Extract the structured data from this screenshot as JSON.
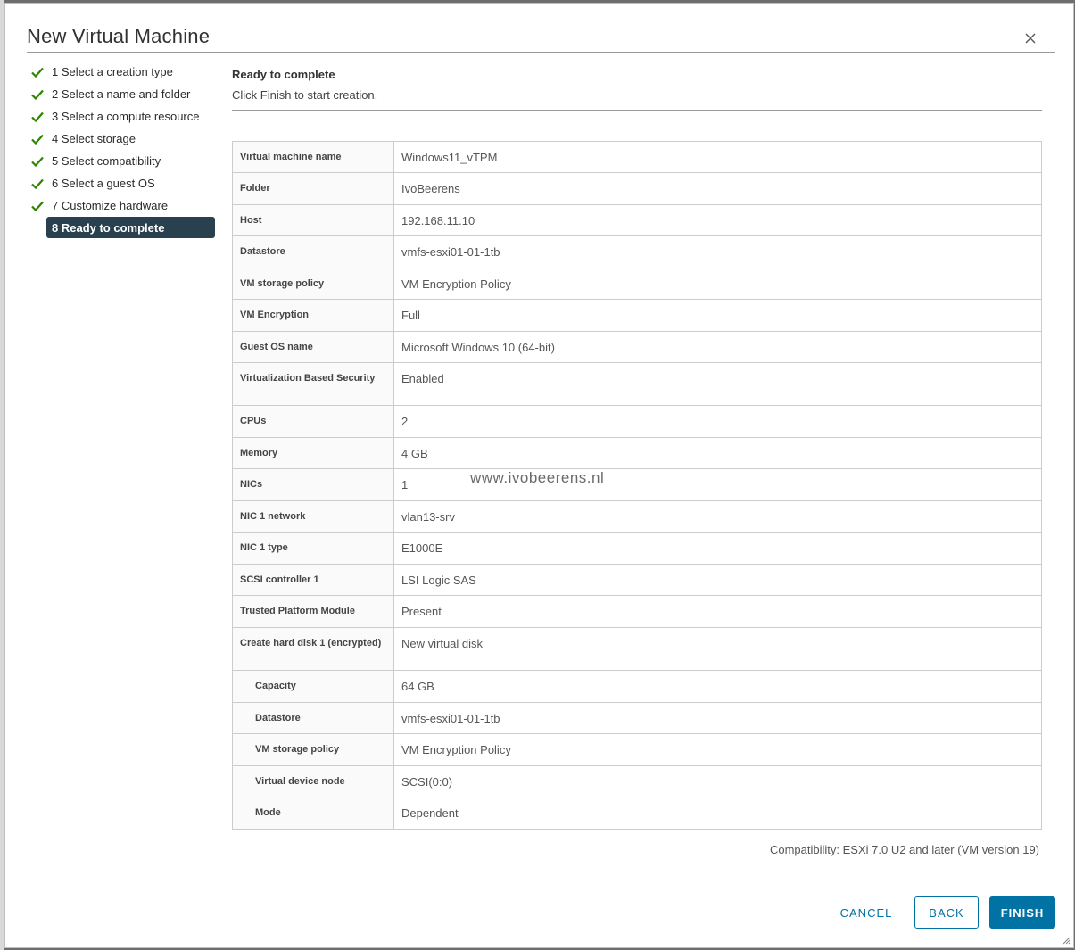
{
  "dialog": {
    "title": "New Virtual Machine",
    "close_icon": "close-icon"
  },
  "steps": [
    {
      "label": "1 Select a creation type",
      "done": true
    },
    {
      "label": "2 Select a name and folder",
      "done": true
    },
    {
      "label": "3 Select a compute resource",
      "done": true
    },
    {
      "label": "4 Select storage",
      "done": true
    },
    {
      "label": "5 Select compatibility",
      "done": true
    },
    {
      "label": "6 Select a guest OS",
      "done": true
    },
    {
      "label": "7 Customize hardware",
      "done": true
    },
    {
      "label": "8 Ready to complete",
      "done": false,
      "active": true
    }
  ],
  "content": {
    "title": "Ready to complete",
    "description": "Click Finish to start creation."
  },
  "summary": [
    {
      "label": "Virtual machine name",
      "value": "Windows11_vTPM"
    },
    {
      "label": "Folder",
      "value": "IvoBeerens"
    },
    {
      "label": "Host",
      "value": "192.168.11.10"
    },
    {
      "label": "Datastore",
      "value": "vmfs-esxi01-01-1tb"
    },
    {
      "label": "VM storage policy",
      "value": "VM Encryption Policy"
    },
    {
      "label": "VM Encryption",
      "value": "Full"
    },
    {
      "label": "Guest OS name",
      "value": "Microsoft Windows 10 (64-bit)"
    },
    {
      "label": "Virtualization Based Security",
      "value": "Enabled"
    },
    {
      "label": "CPUs",
      "value": "2"
    },
    {
      "label": "Memory",
      "value": "4 GB"
    },
    {
      "label": "NICs",
      "value": "1"
    },
    {
      "label": "NIC 1 network",
      "value": "vlan13-srv"
    },
    {
      "label": "NIC 1 type",
      "value": "E1000E"
    },
    {
      "label": "SCSI controller 1",
      "value": "LSI Logic SAS"
    },
    {
      "label": "Trusted Platform Module",
      "value": "Present"
    },
    {
      "label": "Create hard disk 1 (encrypted)",
      "value": "New virtual disk"
    },
    {
      "label": "Capacity",
      "value": "64 GB",
      "sub": true
    },
    {
      "label": "Datastore",
      "value": "vmfs-esxi01-01-1tb",
      "sub": true
    },
    {
      "label": "VM storage policy",
      "value": "VM Encryption Policy",
      "sub": true
    },
    {
      "label": "Virtual device node",
      "value": "SCSI(0:0)",
      "sub": true
    },
    {
      "label": "Mode",
      "value": "Dependent",
      "sub": true
    }
  ],
  "compatibility": "Compatibility: ESXi 7.0 U2 and later (VM version 19)",
  "buttons": {
    "cancel": "CANCEL",
    "back": "BACK",
    "finish": "FINISH"
  },
  "watermark": "www.ivobeerens.nl",
  "colors": {
    "accent": "#0072a3",
    "active_step_bg": "#29414e",
    "check": "#2f8400"
  }
}
